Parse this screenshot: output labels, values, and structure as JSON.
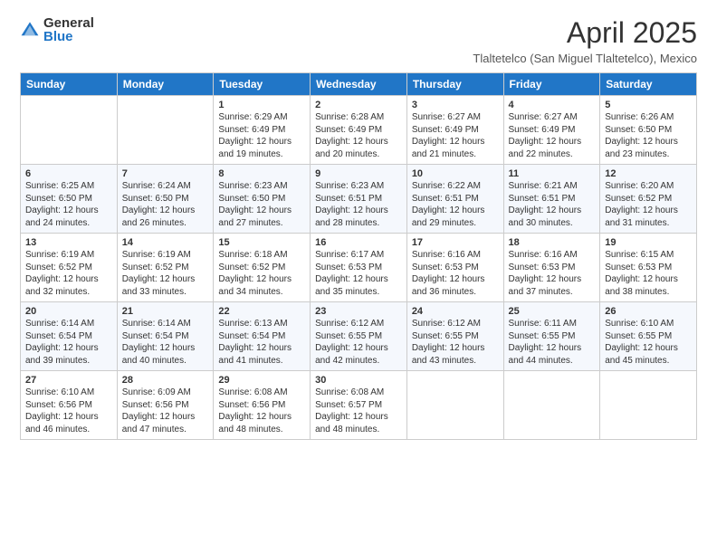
{
  "header": {
    "logo_general": "General",
    "logo_blue": "Blue",
    "main_title": "April 2025",
    "subtitle": "Tlaltetelco (San Miguel Tlaltetelco), Mexico"
  },
  "weekdays": [
    "Sunday",
    "Monday",
    "Tuesday",
    "Wednesday",
    "Thursday",
    "Friday",
    "Saturday"
  ],
  "weeks": [
    [
      {
        "day": "",
        "sunrise": "",
        "sunset": "",
        "daylight": ""
      },
      {
        "day": "",
        "sunrise": "",
        "sunset": "",
        "daylight": ""
      },
      {
        "day": "1",
        "sunrise": "Sunrise: 6:29 AM",
        "sunset": "Sunset: 6:49 PM",
        "daylight": "Daylight: 12 hours and 19 minutes."
      },
      {
        "day": "2",
        "sunrise": "Sunrise: 6:28 AM",
        "sunset": "Sunset: 6:49 PM",
        "daylight": "Daylight: 12 hours and 20 minutes."
      },
      {
        "day": "3",
        "sunrise": "Sunrise: 6:27 AM",
        "sunset": "Sunset: 6:49 PM",
        "daylight": "Daylight: 12 hours and 21 minutes."
      },
      {
        "day": "4",
        "sunrise": "Sunrise: 6:27 AM",
        "sunset": "Sunset: 6:49 PM",
        "daylight": "Daylight: 12 hours and 22 minutes."
      },
      {
        "day": "5",
        "sunrise": "Sunrise: 6:26 AM",
        "sunset": "Sunset: 6:50 PM",
        "daylight": "Daylight: 12 hours and 23 minutes."
      }
    ],
    [
      {
        "day": "6",
        "sunrise": "Sunrise: 6:25 AM",
        "sunset": "Sunset: 6:50 PM",
        "daylight": "Daylight: 12 hours and 24 minutes."
      },
      {
        "day": "7",
        "sunrise": "Sunrise: 6:24 AM",
        "sunset": "Sunset: 6:50 PM",
        "daylight": "Daylight: 12 hours and 26 minutes."
      },
      {
        "day": "8",
        "sunrise": "Sunrise: 6:23 AM",
        "sunset": "Sunset: 6:50 PM",
        "daylight": "Daylight: 12 hours and 27 minutes."
      },
      {
        "day": "9",
        "sunrise": "Sunrise: 6:23 AM",
        "sunset": "Sunset: 6:51 PM",
        "daylight": "Daylight: 12 hours and 28 minutes."
      },
      {
        "day": "10",
        "sunrise": "Sunrise: 6:22 AM",
        "sunset": "Sunset: 6:51 PM",
        "daylight": "Daylight: 12 hours and 29 minutes."
      },
      {
        "day": "11",
        "sunrise": "Sunrise: 6:21 AM",
        "sunset": "Sunset: 6:51 PM",
        "daylight": "Daylight: 12 hours and 30 minutes."
      },
      {
        "day": "12",
        "sunrise": "Sunrise: 6:20 AM",
        "sunset": "Sunset: 6:52 PM",
        "daylight": "Daylight: 12 hours and 31 minutes."
      }
    ],
    [
      {
        "day": "13",
        "sunrise": "Sunrise: 6:19 AM",
        "sunset": "Sunset: 6:52 PM",
        "daylight": "Daylight: 12 hours and 32 minutes."
      },
      {
        "day": "14",
        "sunrise": "Sunrise: 6:19 AM",
        "sunset": "Sunset: 6:52 PM",
        "daylight": "Daylight: 12 hours and 33 minutes."
      },
      {
        "day": "15",
        "sunrise": "Sunrise: 6:18 AM",
        "sunset": "Sunset: 6:52 PM",
        "daylight": "Daylight: 12 hours and 34 minutes."
      },
      {
        "day": "16",
        "sunrise": "Sunrise: 6:17 AM",
        "sunset": "Sunset: 6:53 PM",
        "daylight": "Daylight: 12 hours and 35 minutes."
      },
      {
        "day": "17",
        "sunrise": "Sunrise: 6:16 AM",
        "sunset": "Sunset: 6:53 PM",
        "daylight": "Daylight: 12 hours and 36 minutes."
      },
      {
        "day": "18",
        "sunrise": "Sunrise: 6:16 AM",
        "sunset": "Sunset: 6:53 PM",
        "daylight": "Daylight: 12 hours and 37 minutes."
      },
      {
        "day": "19",
        "sunrise": "Sunrise: 6:15 AM",
        "sunset": "Sunset: 6:53 PM",
        "daylight": "Daylight: 12 hours and 38 minutes."
      }
    ],
    [
      {
        "day": "20",
        "sunrise": "Sunrise: 6:14 AM",
        "sunset": "Sunset: 6:54 PM",
        "daylight": "Daylight: 12 hours and 39 minutes."
      },
      {
        "day": "21",
        "sunrise": "Sunrise: 6:14 AM",
        "sunset": "Sunset: 6:54 PM",
        "daylight": "Daylight: 12 hours and 40 minutes."
      },
      {
        "day": "22",
        "sunrise": "Sunrise: 6:13 AM",
        "sunset": "Sunset: 6:54 PM",
        "daylight": "Daylight: 12 hours and 41 minutes."
      },
      {
        "day": "23",
        "sunrise": "Sunrise: 6:12 AM",
        "sunset": "Sunset: 6:55 PM",
        "daylight": "Daylight: 12 hours and 42 minutes."
      },
      {
        "day": "24",
        "sunrise": "Sunrise: 6:12 AM",
        "sunset": "Sunset: 6:55 PM",
        "daylight": "Daylight: 12 hours and 43 minutes."
      },
      {
        "day": "25",
        "sunrise": "Sunrise: 6:11 AM",
        "sunset": "Sunset: 6:55 PM",
        "daylight": "Daylight: 12 hours and 44 minutes."
      },
      {
        "day": "26",
        "sunrise": "Sunrise: 6:10 AM",
        "sunset": "Sunset: 6:55 PM",
        "daylight": "Daylight: 12 hours and 45 minutes."
      }
    ],
    [
      {
        "day": "27",
        "sunrise": "Sunrise: 6:10 AM",
        "sunset": "Sunset: 6:56 PM",
        "daylight": "Daylight: 12 hours and 46 minutes."
      },
      {
        "day": "28",
        "sunrise": "Sunrise: 6:09 AM",
        "sunset": "Sunset: 6:56 PM",
        "daylight": "Daylight: 12 hours and 47 minutes."
      },
      {
        "day": "29",
        "sunrise": "Sunrise: 6:08 AM",
        "sunset": "Sunset: 6:56 PM",
        "daylight": "Daylight: 12 hours and 48 minutes."
      },
      {
        "day": "30",
        "sunrise": "Sunrise: 6:08 AM",
        "sunset": "Sunset: 6:57 PM",
        "daylight": "Daylight: 12 hours and 48 minutes."
      },
      {
        "day": "",
        "sunrise": "",
        "sunset": "",
        "daylight": ""
      },
      {
        "day": "",
        "sunrise": "",
        "sunset": "",
        "daylight": ""
      },
      {
        "day": "",
        "sunrise": "",
        "sunset": "",
        "daylight": ""
      }
    ]
  ]
}
